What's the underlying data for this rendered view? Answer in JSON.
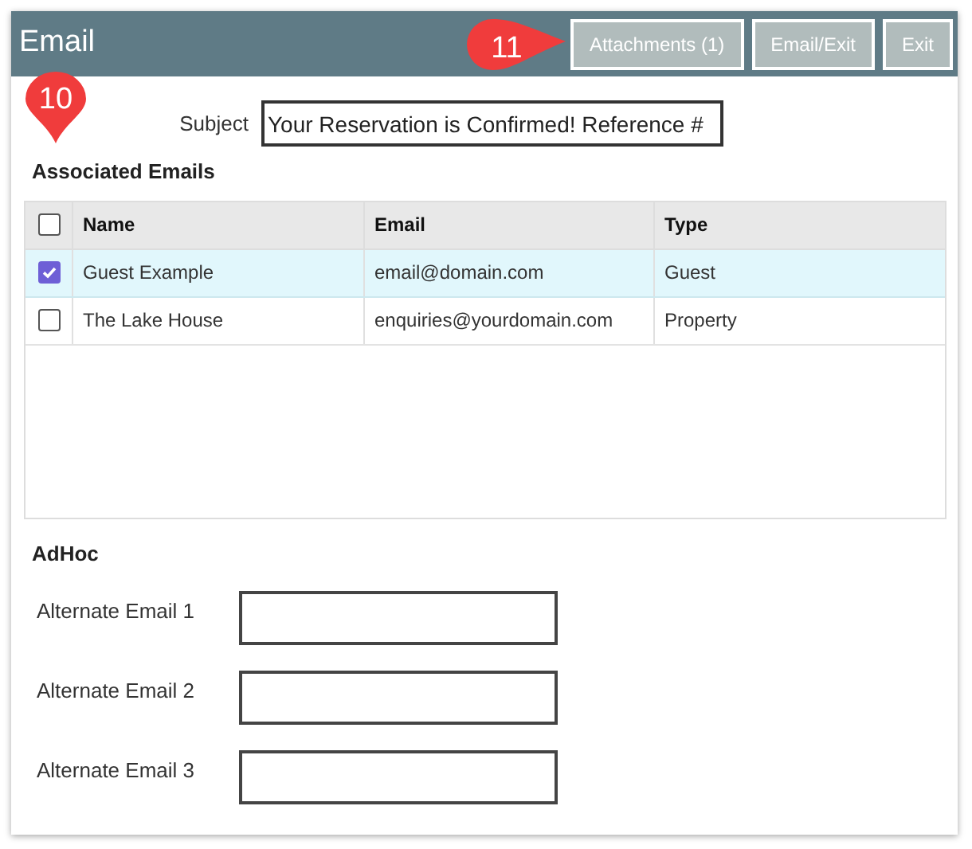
{
  "window": {
    "title": "Email"
  },
  "buttons": [
    {
      "label": "Attachments (1)"
    },
    {
      "label": "Email/Exit"
    },
    {
      "label": "Exit"
    }
  ],
  "subject": {
    "label": "Subject",
    "value": "Your Reservation is Confirmed! Reference #"
  },
  "associated_emails": {
    "heading": "Associated Emails",
    "select_all_checked": false,
    "columns": [
      "Name",
      "Email",
      "Type"
    ],
    "rows": [
      {
        "checked": true,
        "selected": true,
        "cells": [
          "Guest Example",
          "email@domain.com",
          "Guest"
        ]
      },
      {
        "checked": false,
        "selected": false,
        "cells": [
          "The Lake House",
          "enquiries@yourdomain.com",
          "Property"
        ]
      }
    ]
  },
  "adhoc": {
    "heading": "AdHoc",
    "fields": [
      {
        "label": "Alternate Email 1"
      },
      {
        "label": "Alternate Email 2"
      },
      {
        "label": "Alternate Email 3"
      }
    ]
  },
  "callouts": [
    {
      "number": "11",
      "kind": "rightpin"
    },
    {
      "number": "10",
      "kind": "downpin"
    }
  ]
}
